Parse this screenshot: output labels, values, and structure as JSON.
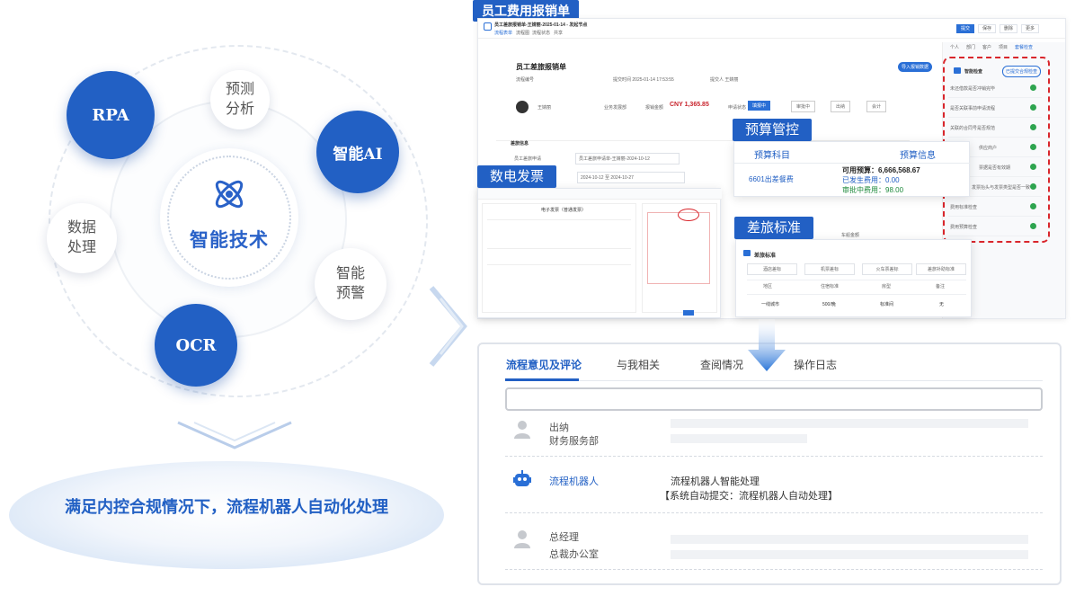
{
  "diagram": {
    "center": {
      "title": "智能技术"
    },
    "bubbles": {
      "rpa": "RPA",
      "ai": "智能AI",
      "ocr": "OCR",
      "forecast": "预测\n分析",
      "data": "数据\n处理",
      "warning": "智能\n预警"
    },
    "bottom_caption": "满足内控合规情况下，流程机器人自动化处理"
  },
  "screenshot": {
    "title_tag": "员工费用报销单",
    "header": {
      "doc_title": "员工差旅报销单-王婧丽-2025-01-14 - 发起节点",
      "tabs": [
        "流程表单",
        "流程图",
        "流程状态",
        "共享"
      ],
      "buttons": [
        "提交",
        "保存",
        "删除",
        "更多"
      ]
    },
    "form": {
      "title": "员工差旅报销单",
      "no_label": "流程编号",
      "submit_time": "提交时间 2025-01-14 17:53:55",
      "submitter": "提交人 王婧丽",
      "person": "王婧丽",
      "dept": "业务发展部",
      "amount_label": "报销金额",
      "amount": "CNY 1,365.85",
      "status_label": "申请状态",
      "steps": [
        "填报中",
        "审批中",
        "出纳",
        "会计"
      ],
      "section": "差旅信息",
      "req_label": "员工差旅申请",
      "req_value": "员工差旅申请单-王婧丽-2024-10-12",
      "date_label": "出差日期",
      "date_value": "2024-10-12 至 2024-10-27",
      "import_btn": "导入报销数据",
      "col_label": "车船金额"
    },
    "right_panel": {
      "tabs": [
        "个人",
        "部门",
        "客户",
        "项目",
        "套餐检查"
      ],
      "check_title": "智能检查",
      "check_btn": "已提交合规检查",
      "items": [
        "未还借款是否冲销完毕",
        "是否关联事前申请流程",
        "关联的合同号是否规范",
        "供应商户",
        "票据是否有效期",
        "发票抬头与发票类型是否一致",
        "费用标准检查",
        "费用预算检查"
      ]
    },
    "budget": {
      "tag": "预算管控",
      "col1": "预算科目",
      "col2": "预算信息",
      "subject": "6601出差餐费",
      "available": "可用预算：6,666,568.67",
      "occurred": "已发生费用：0.00",
      "approving": "审批中费用：98.00"
    },
    "invoice": {
      "tag": "数电发票",
      "title": "电子发票（普通发票）"
    },
    "standard": {
      "tag": "差旅标准",
      "title": "差旅标准",
      "tabs": [
        "酒店差标",
        "机票差标",
        "火车票差标",
        "差旅补助标准"
      ],
      "headers": [
        "地区",
        "住宿标准",
        "房型",
        "备注"
      ],
      "row": [
        "一线城市",
        "500/晚",
        "标准间",
        "无"
      ]
    }
  },
  "comments": {
    "tabs": [
      "流程意见及评论",
      "与我相关",
      "查阅情况",
      "操作日志"
    ],
    "rows": [
      {
        "name": "出纳",
        "dept": "财务服务部"
      },
      {
        "name": "流程机器人",
        "line1": "流程机器人智能处理",
        "line2": "【系统自动提交：流程机器人自动处理】"
      },
      {
        "name": "总经理",
        "dept": "总裁办公室"
      }
    ]
  },
  "colors": {
    "brand": "#2260c4",
    "success": "#2ea44f",
    "alert": "#d9262c"
  }
}
